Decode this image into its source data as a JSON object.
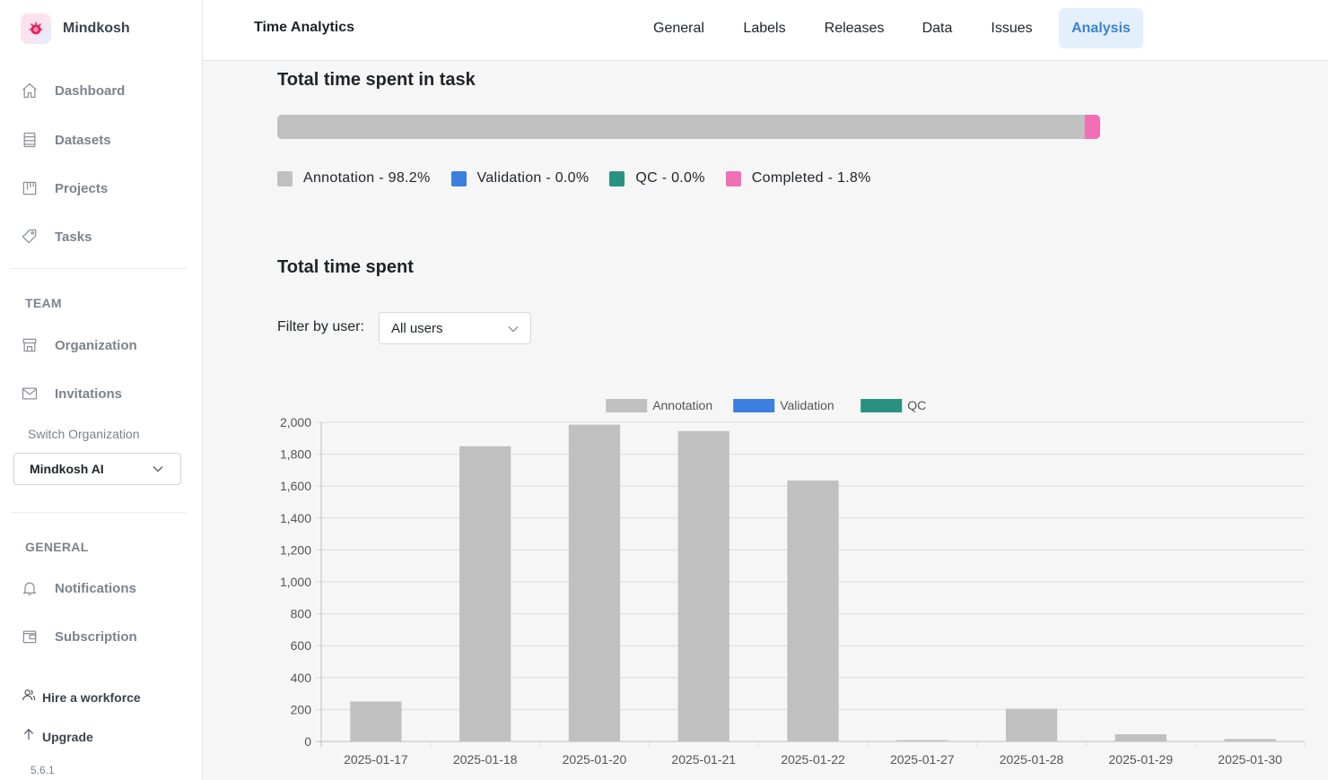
{
  "sidebar": {
    "brand": "Mindkosh",
    "nav": [
      {
        "label": "Dashboard",
        "icon": "home-icon"
      },
      {
        "label": "Datasets",
        "icon": "datasets-icon"
      },
      {
        "label": "Projects",
        "icon": "projects-icon"
      },
      {
        "label": "Tasks",
        "icon": "tag-icon"
      }
    ],
    "team_title": "TEAM",
    "team_nav": [
      {
        "label": "Organization",
        "icon": "store-icon"
      },
      {
        "label": "Invitations",
        "icon": "mail-icon"
      }
    ],
    "switch_org_label": "Switch Organization",
    "org_selected": "Mindkosh AI",
    "general_title": "GENERAL",
    "general_nav": [
      {
        "label": "Notifications",
        "icon": "bell-icon"
      },
      {
        "label": "Subscription",
        "icon": "wallet-icon"
      }
    ],
    "hire_label": "Hire a workforce",
    "upgrade_label": "Upgrade",
    "version": "5.6.1"
  },
  "header": {
    "title": "Time Analytics",
    "tabs": [
      {
        "label": "General"
      },
      {
        "label": "Labels"
      },
      {
        "label": "Releases"
      },
      {
        "label": "Data"
      },
      {
        "label": "Issues"
      },
      {
        "label": "Analysis",
        "active": true
      }
    ]
  },
  "task_time": {
    "title": "Total time spent in task",
    "segments": [
      {
        "name": "Annotation",
        "value_text": "98.2%",
        "fraction": 0.982,
        "color": "#c0c0c0"
      },
      {
        "name": "Validation",
        "value_text": "0.0%",
        "fraction": 0.0,
        "color": "#3b7fe0"
      },
      {
        "name": "QC",
        "value_text": "0.0%",
        "fraction": 0.0,
        "color": "#2a9182"
      },
      {
        "name": "Completed",
        "value_text": "1.8%",
        "fraction": 0.018,
        "color": "#f06fb5"
      }
    ],
    "separator": " - "
  },
  "time_spent": {
    "title": "Total time spent",
    "filter_label": "Filter by user:",
    "filter_value": "All users"
  },
  "chart_data": {
    "type": "bar",
    "categories": [
      "2025-01-17",
      "2025-01-18",
      "2025-01-20",
      "2025-01-21",
      "2025-01-22",
      "2025-01-27",
      "2025-01-28",
      "2025-01-29",
      "2025-01-30"
    ],
    "series": [
      {
        "name": "Annotation",
        "color": "#c0c0c0",
        "values": [
          250,
          1850,
          1985,
          1945,
          1635,
          8,
          205,
          45,
          15
        ]
      },
      {
        "name": "Validation",
        "color": "#3b7fe0",
        "values": [
          0,
          0,
          0,
          0,
          0,
          0,
          0,
          0,
          0
        ]
      },
      {
        "name": "QC",
        "color": "#2a9182",
        "values": [
          0,
          0,
          0,
          0,
          0,
          0,
          0,
          0,
          0
        ]
      }
    ],
    "ylim": [
      0,
      2000
    ],
    "yticks": [
      "0",
      "200",
      "400",
      "600",
      "800",
      "1,000",
      "1,200",
      "1,400",
      "1,600",
      "1,800",
      "2,000"
    ],
    "grid": true,
    "legend": "top-center"
  }
}
